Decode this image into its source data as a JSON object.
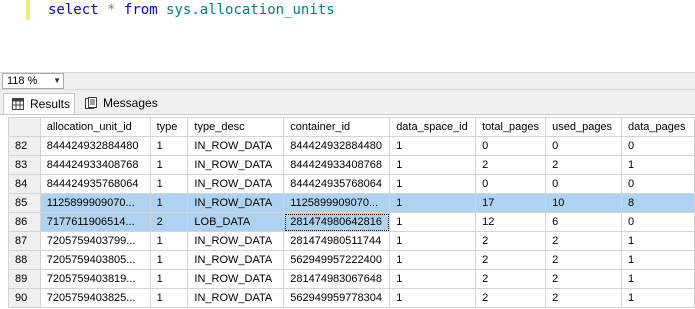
{
  "editor": {
    "kw_select": "select",
    "star": "*",
    "kw_from": "from",
    "table_name": "sys.allocation_units"
  },
  "zoom": {
    "value": "118 %"
  },
  "tabs": [
    {
      "label": "Results",
      "icon": "grid-icon"
    },
    {
      "label": "Messages",
      "icon": "messages-icon"
    }
  ],
  "grid": {
    "columns": [
      "allocation_unit_id",
      "type",
      "type_desc",
      "container_id",
      "data_space_id",
      "total_pages",
      "used_pages",
      "data_pages"
    ],
    "rows": [
      {
        "num": "82",
        "cells": [
          "844424932884480",
          "1",
          "IN_ROW_DATA",
          "844424932884480",
          "1",
          "0",
          "0",
          "0"
        ]
      },
      {
        "num": "83",
        "cells": [
          "844424933408768",
          "1",
          "IN_ROW_DATA",
          "844424933408768",
          "1",
          "2",
          "2",
          "1"
        ]
      },
      {
        "num": "84",
        "cells": [
          "844424935768064",
          "1",
          "IN_ROW_DATA",
          "844424935768064",
          "1",
          "0",
          "0",
          "0"
        ]
      },
      {
        "num": "85",
        "cells": [
          "1125899909070...",
          "1",
          "IN_ROW_DATA",
          "1125899909070...",
          "1",
          "17",
          "10",
          "8"
        ]
      },
      {
        "num": "86",
        "cells": [
          "7177611906514...",
          "2",
          "LOB_DATA",
          "281474980642816",
          "1",
          "12",
          "6",
          "0"
        ]
      },
      {
        "num": "87",
        "cells": [
          "7205759403799...",
          "1",
          "IN_ROW_DATA",
          "281474980511744",
          "1",
          "2",
          "2",
          "1"
        ]
      },
      {
        "num": "88",
        "cells": [
          "7205759403805...",
          "1",
          "IN_ROW_DATA",
          "562949957222400",
          "1",
          "2",
          "2",
          "1"
        ]
      },
      {
        "num": "89",
        "cells": [
          "7205759403819...",
          "1",
          "IN_ROW_DATA",
          "281474983067648",
          "1",
          "2",
          "2",
          "1"
        ]
      },
      {
        "num": "90",
        "cells": [
          "7205759403825...",
          "1",
          "IN_ROW_DATA",
          "562949959778304",
          "1",
          "2",
          "2",
          "1"
        ]
      }
    ]
  },
  "colors": {
    "selection": "#aed3f2",
    "editor_keyword": "#0000ff",
    "editor_identifier": "#008080"
  }
}
